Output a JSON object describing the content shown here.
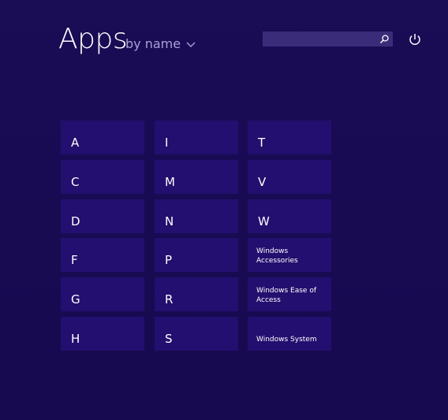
{
  "header": {
    "title": "Apps",
    "sort_label": "by name"
  },
  "search": {
    "placeholder": "",
    "value": ""
  },
  "colors": {
    "background": "#190b52",
    "tile": "#230f6f",
    "search_box": "#3a2c78",
    "sort_label": "#a9a1d6"
  },
  "icons": {
    "sort": "chevron-down-icon",
    "search": "search-icon",
    "power": "power-icon"
  },
  "groups": {
    "col1": [
      "A",
      "C",
      "D",
      "F",
      "G",
      "H"
    ],
    "col2": [
      "I",
      "M",
      "N",
      "P",
      "R",
      "S"
    ],
    "col3": [
      "T",
      "V",
      "W",
      "Windows Accessories",
      "Windows Ease of Access",
      "Windows System"
    ]
  }
}
